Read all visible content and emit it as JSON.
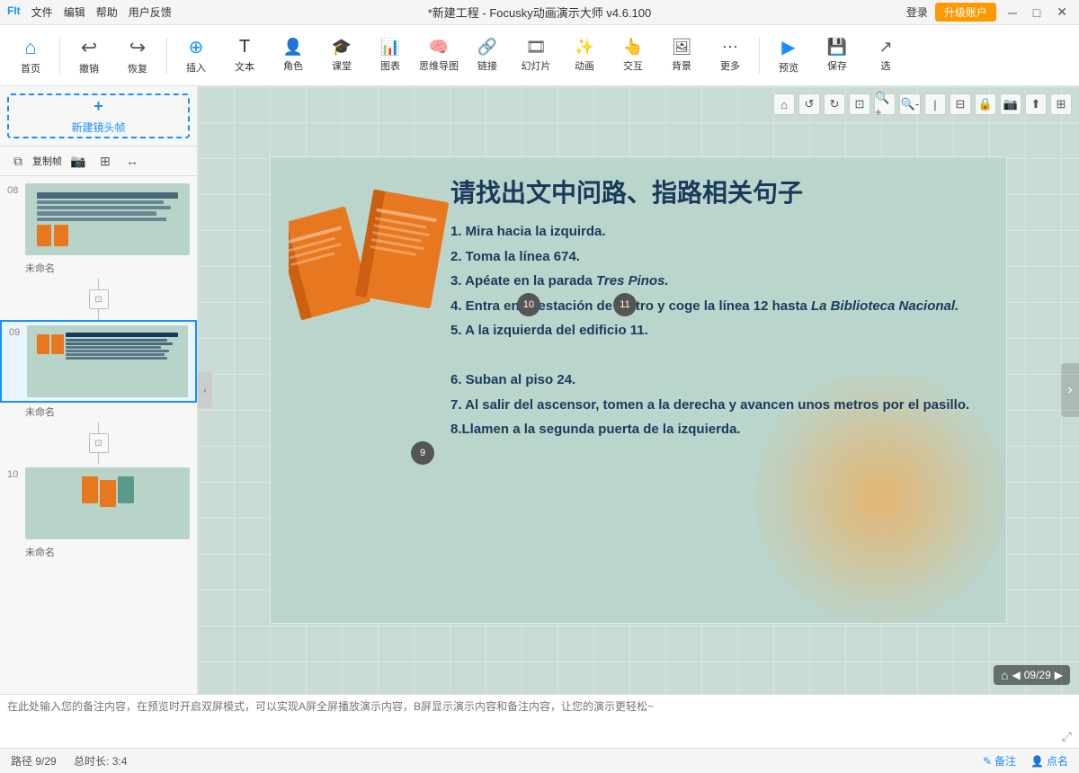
{
  "titlebar": {
    "menu_items": [
      "文件",
      "编辑",
      "帮助",
      "用户反馈"
    ],
    "title": "*新建工程 - Focusky动画演示大师  v4.6.100",
    "login": "登录",
    "upgrade": "升级账户",
    "win_min": "─",
    "win_restore": "□",
    "win_close": "✕",
    "app_icon": "FIt"
  },
  "toolbar": {
    "items": [
      {
        "label": "首页",
        "icon": "🏠"
      },
      {
        "label": "撤销",
        "icon": "↩"
      },
      {
        "label": "恢复",
        "icon": "↪"
      },
      {
        "label": "插入",
        "icon": "+"
      },
      {
        "label": "文本",
        "icon": "T"
      },
      {
        "label": "角色",
        "icon": "👤"
      },
      {
        "label": "课堂",
        "icon": "🎓"
      },
      {
        "label": "图表",
        "icon": "📊"
      },
      {
        "label": "思维导图",
        "icon": "🧠"
      },
      {
        "label": "链接",
        "icon": "🔗"
      },
      {
        "label": "幻灯片",
        "icon": "🎞"
      },
      {
        "label": "动画",
        "icon": "✨"
      },
      {
        "label": "交互",
        "icon": "👆"
      },
      {
        "label": "背景",
        "icon": "🖼"
      },
      {
        "label": "更多",
        "icon": "⋯"
      },
      {
        "label": "预览",
        "icon": "▶"
      },
      {
        "label": "保存",
        "icon": "💾"
      },
      {
        "label": "选",
        "icon": "↗"
      }
    ]
  },
  "left_panel": {
    "new_frame_label": "新建镜头帧",
    "thumb_tools": [
      "复制帧",
      "📷",
      "⊞",
      "↔"
    ],
    "slides": [
      {
        "num": "08",
        "label": "未命名",
        "active": false
      },
      {
        "num": "09",
        "label": "未命名",
        "active": true
      },
      {
        "num": "10",
        "label": "未命名",
        "active": false
      }
    ]
  },
  "canvas": {
    "badge_10": "10",
    "badge_11": "11",
    "badge_9": "9"
  },
  "slide": {
    "title": "请找出文中问路、指路相关句子",
    "lines": [
      "1. Mira hacia la izquirda.",
      "2. Toma la línea 674.",
      "3. Apéate en la parada Tres Pinos.",
      "4. Entra en la estación de metro y coge la línea 12 hasta La Biblioteca Nacional.",
      "5. A la izquierda del edificio 11.",
      "",
      "6. Suban al piso 24.",
      "7. Al salir del ascensor, tomen a la derecha y avancen unos metros por el pasillo.",
      "8.Llamen a la segunda puerta de la izquierda."
    ],
    "line3_italic": "Tres Pinos.",
    "line4_italic": "La Biblioteca Nacional."
  },
  "bottom_nav": {
    "current": "09/29"
  },
  "notes": {
    "placeholder": "在此处输入您的备注内容，在预览时开启双屏模式，可以实现A屏全屏播放演示内容，B屏显示演示内容和备注内容，让您的演示更轻松~"
  },
  "statusbar": {
    "path": "路径 9/29",
    "total": "总时长: 3:4",
    "note_btn": "备注",
    "point_btn": "点名"
  }
}
